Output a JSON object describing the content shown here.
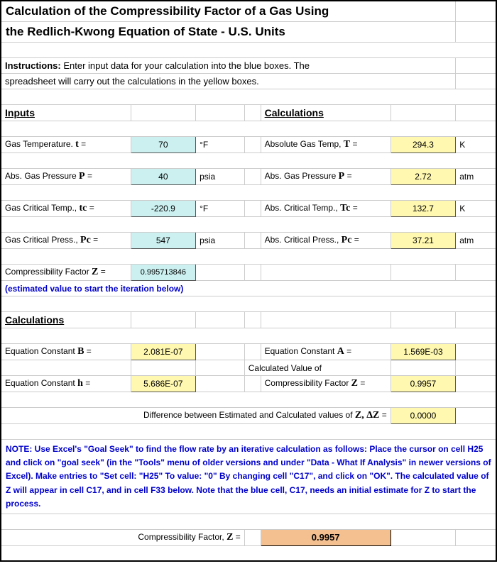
{
  "title_line1": "Calculation of the Compressibility Factor of a Gas Using",
  "title_line2": "the Redlich-Kwong Equation of State  -  U.S. Units",
  "instructions_label": "Instructions:",
  "instructions_line1": "Enter input data for your calculation into the blue boxes.  The",
  "instructions_line2": "spreadsheet will carry out the calculations in the yellow boxes.",
  "inputs_hdr": "Inputs",
  "calcs_hdr": "Calculations",
  "rows": {
    "temp": {
      "label_a": "Gas Temperature. ",
      "sym_a": "t",
      "eq": " =",
      "val_a": "70",
      "unit_a": "°F",
      "label_b": "Absolute Gas Temp, ",
      "sym_b": "T",
      "val_b": "294.3",
      "unit_b": "K"
    },
    "press": {
      "label_a": "Abs. Gas Pressure ",
      "sym_a": "P",
      "eq": " =",
      "val_a": "40",
      "unit_a": "psia",
      "label_b": "Abs. Gas Pressure ",
      "sym_b": "P",
      "val_b": "2.72",
      "unit_b": "atm"
    },
    "tc": {
      "label_a": "Gas Critical Temp., ",
      "sym_a": "tc",
      "eq": " =",
      "val_a": "-220.9",
      "unit_a": "°F",
      "label_b": "Abs. Critical Temp., ",
      "sym_b": "Tc",
      "val_b": "132.7",
      "unit_b": "K"
    },
    "pc": {
      "label_a": "Gas Critical Press., ",
      "sym_a": "Pc",
      "eq": " =",
      "val_a": "547",
      "unit_a": "psia",
      "label_b": "Abs. Critical Press., ",
      "sym_b": "Pc",
      "val_b": "37.21",
      "unit_b": "atm"
    },
    "z": {
      "label_a": "Compressibility Factor ",
      "sym_a": "Z",
      "eq": " =",
      "val_a": "0.995713846"
    }
  },
  "z_note": "(estimated value to start the iteration below)",
  "calcs2_hdr": "Calculations",
  "eqB": {
    "label": "Equation Constant ",
    "sym": "B",
    "eq": " =",
    "val": "2.081E-07",
    "label_b": "Equation Constant ",
    "sym_b": "A",
    "val_b": "1.569E-03"
  },
  "calc_val_of": "Calculated Value of",
  "eqH": {
    "label": "Equation Constant ",
    "sym": "h",
    "eq": " =",
    "val": "5.686E-07",
    "label_b": "Compressibility Factor ",
    "sym_b": "Z",
    "val_b": "0.9957"
  },
  "dz": {
    "label": "Difference between Estimated and Calculated values of ",
    "sym": "Z, ΔZ",
    "eq": " =",
    "val": "0.0000"
  },
  "note": "NOTE:  Use Excel's \"Goal Seek\" to find the flow rate by an iterative calculation as follows:  Place the cursor on cell H25 and click on \"goal seek\" (in the \"Tools\" menu of older versions and under \"Data - What If Analysis\" in newer versions of Excel).  Make entries to \"Set cell: \"H25\" To value: \"0\" By changing cell \"C17\", and click on \"OK\".  The calculated value of Z will appear in cell C17, and in cell F33 below.  Note that the blue cell, C17, needs an initial estimate for Z to start the process.",
  "final": {
    "label": "Compressibility Factor, ",
    "sym": "Z",
    "eq": " =",
    "val": "0.9957"
  }
}
